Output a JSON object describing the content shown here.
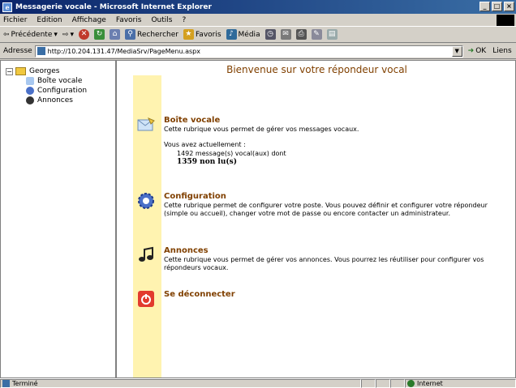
{
  "window": {
    "title": "Messagerie vocale - Microsoft Internet Explorer",
    "icon": "ie-logo-icon"
  },
  "menu": [
    "Fichier",
    "Edition",
    "Affichage",
    "Favoris",
    "Outils",
    "?"
  ],
  "toolbar": {
    "back": "Précédente",
    "search": "Rechercher",
    "favorites": "Favoris",
    "media": "Média"
  },
  "address": {
    "label": "Adresse",
    "url": "http://10.204.131.47/MediaSrv/PageMenu.aspx",
    "go": "OK",
    "links": "Liens"
  },
  "tree": {
    "root": "Georges",
    "items": [
      "Boîte vocale",
      "Configuration",
      "Annonces"
    ]
  },
  "page": {
    "title": "Bienvenue sur votre répondeur vocal",
    "voicemail": {
      "title": "Boîte vocale",
      "desc": "Cette rubrique vous permet de gérer vos messages vocaux.",
      "current": "Vous avez actuellement :",
      "count": "1492 message(s) vocal(aux) dont",
      "unread": "1359 non lu(s)"
    },
    "config": {
      "title": "Configuration",
      "desc": "Cette rubrique permet de configurer votre poste. Vous pouvez définir et configurer votre répondeur (simple ou accueil), changer votre mot de passe ou encore contacter un administrateur."
    },
    "announces": {
      "title": "Annonces",
      "desc": "Cette rubrique vous permet de gérer vos annonces. Vous pourrez les réutiliser pour configurer vos répondeurs vocaux."
    },
    "logout": {
      "title": "Se déconnecter"
    }
  },
  "status": {
    "text": "Terminé",
    "zone": "Internet"
  },
  "colors": {
    "accent": "#804000",
    "sidebar": "#fff3b0",
    "titlebar": "#0a246a"
  }
}
